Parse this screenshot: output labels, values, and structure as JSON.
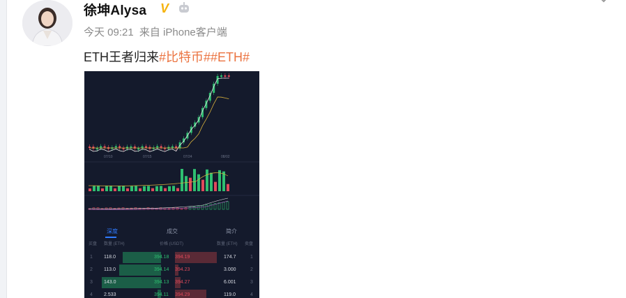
{
  "post": {
    "author_name": "徐坤Alysa",
    "verified_badge": "V",
    "time": "今天 09:21",
    "source": "来自 iPhone客户端",
    "text": "ETH王者归来",
    "tags": [
      "#比特币#",
      "#ETH#"
    ]
  },
  "icons": {
    "avatar": "avatar-photo",
    "verified": "verified-v-icon",
    "robot": "robot-icon",
    "more": "chevron-down-icon"
  },
  "screenshot": {
    "date_labels": [
      "07/10",
      "07/15",
      "07/24",
      "08/02"
    ],
    "tabs": [
      "深度",
      "成交",
      "简介"
    ],
    "orderbook_headers": [
      "买盘",
      "数量 (ETH)",
      "价格 (USDT)",
      "数量 (ETH)",
      "卖盘"
    ],
    "orderbook_rows": [
      {
        "n": "1",
        "bid_qty": "118.0",
        "bid_price": "394.18",
        "ask_price": "394.19",
        "ask_qty": "174.7",
        "bid_fill": 0.55,
        "ask_fill": 0.6
      },
      {
        "n": "2",
        "bid_qty": "113.0",
        "bid_price": "394.14",
        "ask_price": "394.23",
        "ask_qty": "3.000",
        "bid_fill": 0.6,
        "ask_fill": 0.05
      },
      {
        "n": "3",
        "bid_qty": "143.0",
        "bid_price": "394.13",
        "ask_price": "394.27",
        "ask_qty": "6.001",
        "bid_fill": 0.85,
        "ask_fill": 0.08
      },
      {
        "n": "4",
        "bid_qty": "2.533",
        "bid_price": "394.11",
        "ask_price": "394.29",
        "ask_qty": "119.0",
        "bid_fill": 0.05,
        "ask_fill": 0.45
      }
    ]
  },
  "colors": {
    "tag": "#eb7340",
    "up": "#2fbf71",
    "down": "#e0495b",
    "chart_bg": "#141a2c"
  }
}
